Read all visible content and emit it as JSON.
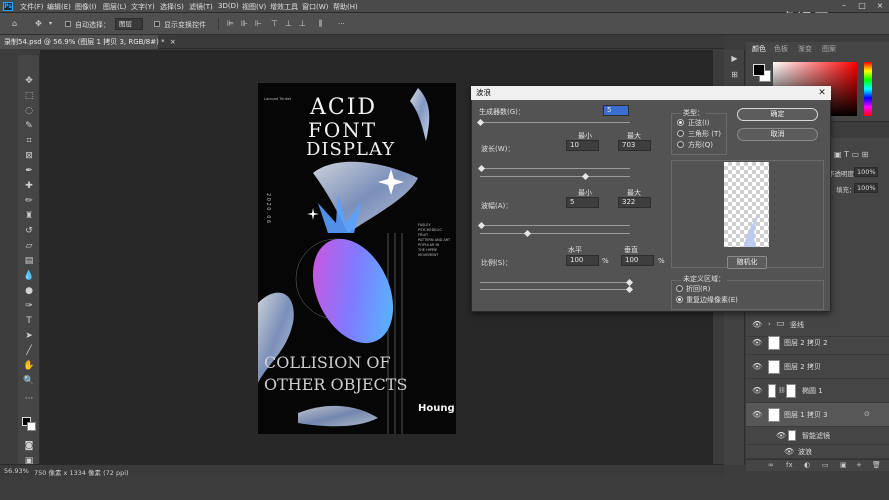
{
  "menu": {
    "items": [
      "文件(F)",
      "编辑(E)",
      "图像(I)",
      "图层(L)",
      "文字(Y)",
      "选择(S)",
      "滤镜(T)",
      "3D(D)",
      "视图(V)",
      "增效工具",
      "窗口(W)",
      "帮助(H)"
    ],
    "logo": "Ps"
  },
  "options": {
    "auto_select_label": "自动选择：",
    "auto_select_value": "图层",
    "show_transform_label": "显示变换控件",
    "more": "···"
  },
  "document": {
    "tab_title": "录制54.psd @ 56.9% (图层 1 拷贝 3, RGB/8#) *",
    "tab_close": "×"
  },
  "status": {
    "zoom": "56.93%",
    "size": "750 像素 x 1334 像素 (72 ppi)"
  },
  "artwork": {
    "brand_small": "Laround Trinket",
    "line1": "ACID",
    "line2": "FONT",
    "line3": "DISPLAY",
    "bottom1": "COLLISION OF",
    "bottom2": "OTHER OBJECTS",
    "signature": "Houng",
    "year_vertical": "2 0 2 0 . 0 6",
    "side_text": "FASLEY\nPSYCHEDELIC\nFRUIT\nPATTERN AND ART\nPOPULAR IN\nTHE HIPPIE\nMOVEMENT"
  },
  "dialog": {
    "title": "波浪",
    "generators_label": "生成器数(G)：",
    "generators_value": "5",
    "min_label": "最小",
    "max_label": "最大",
    "wavelength_label": "波长(W)：",
    "wavelength_min": "10",
    "wavelength_max": "703",
    "amplitude_label": "波幅(A)：",
    "amplitude_min": "5",
    "amplitude_max": "322",
    "horizontal_label": "水平",
    "vertical_label": "垂直",
    "scale_label": "比例(S)：",
    "scale_h": "100",
    "scale_v": "100",
    "percent": "%",
    "type_label": "类型：",
    "type_options": [
      "正弦(I)",
      "三角形 (T)",
      "方形(Q)"
    ],
    "ok_button": "确定",
    "cancel_button": "取消",
    "randomize_button": "随机化",
    "undefined_label": "未定义区域：",
    "undefined_options": [
      "折回(R)",
      "重复边缘像素(E)"
    ]
  },
  "panels": {
    "color_tabs": [
      "颜色",
      "色板",
      "渐变",
      "图案"
    ],
    "opacity_label": "不透明度：",
    "opacity_value": "100%",
    "fill_label": "填充：",
    "fill_value": "100%",
    "layers": [
      {
        "name": "竖线",
        "type": "group"
      },
      {
        "name": "图层 2 拷贝 2",
        "type": "layer"
      },
      {
        "name": "图层 2 拷贝",
        "type": "layer"
      },
      {
        "name": "椭圆 1",
        "type": "shape"
      },
      {
        "name": "图层 1 拷贝 3",
        "type": "smart"
      },
      {
        "name": "智能滤镜",
        "type": "filter-mask"
      },
      {
        "name": "波浪",
        "type": "filter"
      }
    ],
    "footer_icons": [
      "∞",
      "fx",
      "◐",
      "▭",
      "▣",
      "+",
      "🗑"
    ]
  },
  "watermark": "虎课网",
  "colors": {
    "ui_dark": "#3c3c3c",
    "dialog": "#535353",
    "accent": "#31a8ff"
  }
}
